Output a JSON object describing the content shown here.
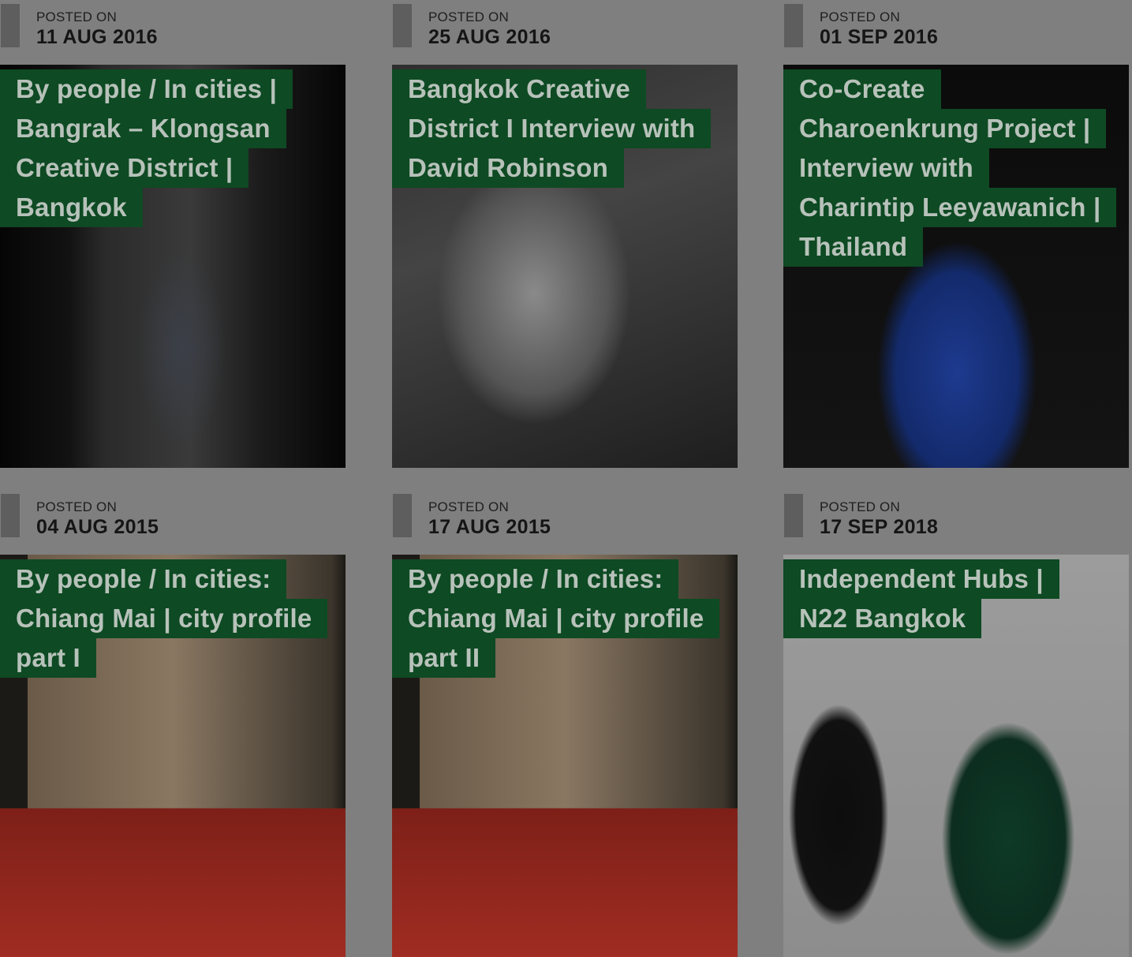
{
  "posts": [
    {
      "posted_label": "POSTED ON",
      "date": "11 AUG 2016",
      "title_lines": [
        "By people / In cities |",
        "Bangrak – Klongsan",
        "Creative District |",
        "Bangkok"
      ],
      "image": "night-building-mural"
    },
    {
      "posted_label": "POSTED ON",
      "date": "25 AUG 2016",
      "title_lines": [
        "Bangkok Creative",
        "District I Interview with",
        "David Robinson"
      ],
      "image": "portrait-bw"
    },
    {
      "posted_label": "POSTED ON",
      "date": "01 SEP 2016",
      "title_lines": [
        "Co-Create",
        "Charoenkrung Project |",
        "Interview with",
        "Charintip Leeyawanich |",
        "Thailand"
      ],
      "image": "portrait-blue-cardigan"
    },
    {
      "posted_label": "POSTED ON",
      "date": "04 AUG 2015",
      "title_lines": [
        "By people / In cities:",
        "Chiang Mai | city profile",
        "part I"
      ],
      "image": "collage-chiang-mai"
    },
    {
      "posted_label": "POSTED ON",
      "date": "17 AUG 2015",
      "title_lines": [
        "By people / In cities:",
        "Chiang Mai | city profile",
        "part II"
      ],
      "image": "collage-chiang-mai"
    },
    {
      "posted_label": "POSTED ON",
      "date": "17 SEP 2018",
      "title_lines": [
        "Independent Hubs |",
        "N22 Bangkok"
      ],
      "image": "people-gallery"
    }
  ]
}
